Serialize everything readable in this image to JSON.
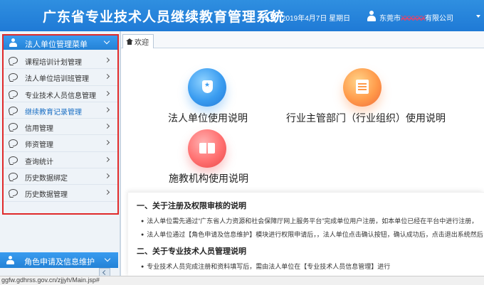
{
  "header": {
    "title": "广东省专业技术人员继续教育管理系统",
    "date": "2019年4月7日 星期日",
    "user_prefix": "东莞市",
    "user_redacted": "XXXXXX",
    "user_suffix": "有限公司"
  },
  "sidebar": {
    "menu_title": "法人单位管理菜单",
    "items": [
      {
        "label": "课程培训计划管理"
      },
      {
        "label": "法人单位培训班管理"
      },
      {
        "label": "专业技术人员信息管理"
      },
      {
        "label": "继续教育记录管理"
      },
      {
        "label": "信用管理"
      },
      {
        "label": "师资管理"
      },
      {
        "label": "查询统计"
      },
      {
        "label": "历史数据绑定"
      },
      {
        "label": "历史数据管理"
      }
    ],
    "role_title": "角色申请及信息维护"
  },
  "tabs": [
    {
      "label": "欢迎"
    }
  ],
  "guides": {
    "legal": "法人单位使用说明",
    "industry": "行业主管部门（行业组织）使用说明",
    "institution": "施教机构使用说明"
  },
  "notice": {
    "sec1": "一、关于注册及权限审核的说明",
    "b1": "法人单位需先通过“广东省人力资源和社会保障厅网上服务平台”完成单位用户注册，如本单位已经在平台中进行注册，",
    "b2": "法人单位通过【角色申请及信息维护】模块进行权限申请后，，法人单位点击确认按钮，确认成功后，点击退出系统然后",
    "sec2": "二、关于专业技术人员管理说明",
    "b3": "专业技术人员完成注册和资料填写后，需由法人单位在【专业技术人员信息管理】进行"
  },
  "status": {
    "url": "ggfw.gdhrss.gov.cn/zjjyh/Main.jsp#"
  },
  "colors": {
    "header_blue": "#1f7ad6",
    "highlight_red": "#e02a2a"
  }
}
